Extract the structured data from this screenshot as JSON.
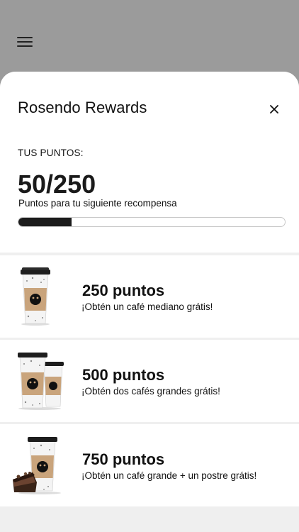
{
  "header": {
    "menu_icon": "hamburger-menu-icon"
  },
  "rewards_sheet": {
    "title": "Rosendo Rewards",
    "close_icon": "close-icon",
    "points_label": "TUS PUNTOS:",
    "points_display": "50/250",
    "points_subtitle": "Puntos para tu siguiente recompensa",
    "progress": {
      "current": 50,
      "target": 250,
      "fraction": 0.2
    }
  },
  "rewards": [
    {
      "points": "250 puntos",
      "description": "¡Obtén un café mediano grátis!",
      "image": "single-coffee-cup"
    },
    {
      "points": "500 puntos",
      "description": "¡Obtén dos cafés grandes grátis!",
      "image": "two-coffee-cups"
    },
    {
      "points": "750 puntos",
      "description": "¡Obtén un café grande + un postre grátis!",
      "image": "coffee-cup-and-cake"
    }
  ],
  "colors": {
    "backdrop": "#9b9b9b",
    "sheet": "#ffffff",
    "accent": "#1c1c1c",
    "cup_sleeve": "#c9a47c"
  }
}
